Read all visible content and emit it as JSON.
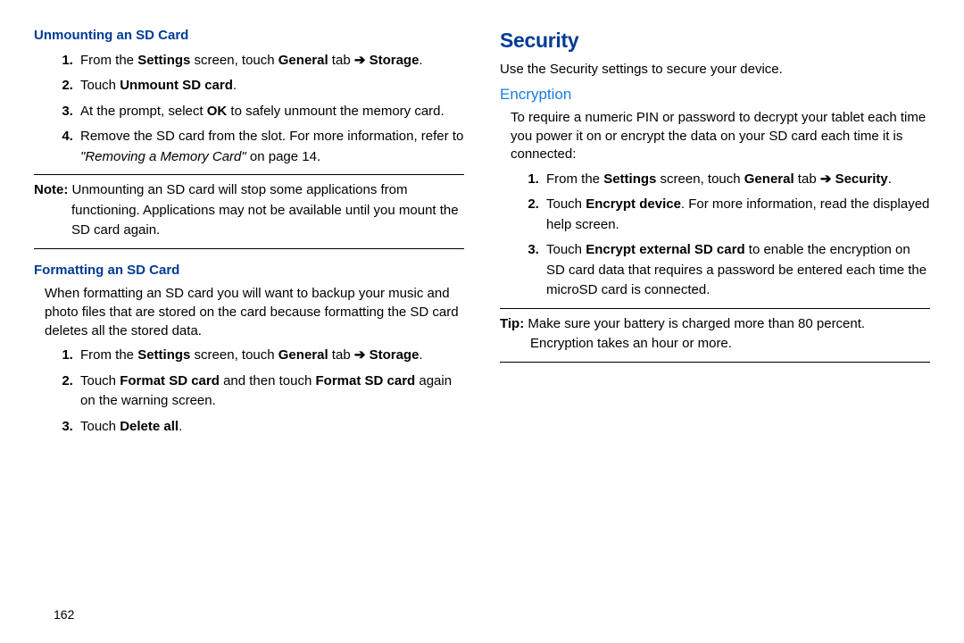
{
  "left": {
    "unmount": {
      "heading": "Unmounting an SD Card",
      "steps": [
        {
          "pre": "From the ",
          "b1": "Settings",
          "mid1": " screen, touch ",
          "b2": "General",
          "mid2": " tab ",
          "arrow": "➔",
          "b3": " Storage",
          "post": "."
        },
        {
          "pre": "Touch ",
          "b1": "Unmount SD card",
          "post": "."
        },
        {
          "pre": "At the prompt, select ",
          "b1": "OK",
          "post": " to safely unmount the memory card."
        },
        {
          "pre": "Remove the SD card from the slot. For more information, refer to ",
          "i1": "\"Removing a Memory Card\"",
          "post": " on page 14."
        }
      ],
      "note_label": "Note:",
      "note_body": " Unmounting an SD card will stop some applications from functioning. Applications may not be available until you mount the SD card again."
    },
    "format": {
      "heading": "Formatting an SD Card",
      "intro": "When formatting an SD card you will want to backup your music and photo files that are stored on the card because formatting the SD card deletes all the stored data.",
      "steps": [
        {
          "pre": "From the ",
          "b1": "Settings",
          "mid1": " screen, touch ",
          "b2": "General",
          "mid2": " tab ",
          "arrow": "➔",
          "b3": " Storage",
          "post": "."
        },
        {
          "pre": "Touch ",
          "b1": "Format SD card",
          "mid1": " and then touch ",
          "b2": "Format SD card",
          "post": " again on the warning screen."
        },
        {
          "pre": "Touch ",
          "b1": "Delete all",
          "post": "."
        }
      ]
    }
  },
  "right": {
    "security": {
      "heading": "Security",
      "intro": "Use the Security settings to secure your device."
    },
    "encryption": {
      "heading": "Encryption",
      "intro": "To require a numeric PIN or password to decrypt your tablet each time you power it on or encrypt the data on your SD card each time it is connected:",
      "steps": [
        {
          "pre": "From the ",
          "b1": "Settings",
          "mid1": " screen, touch ",
          "b2": "General",
          "mid2": " tab ",
          "arrow": "➔",
          "b3": " Security",
          "post": "."
        },
        {
          "pre": "Touch ",
          "b1": "Encrypt device",
          "post": ". For more information, read the displayed help screen."
        },
        {
          "pre": "Touch ",
          "b1": "Encrypt external SD card",
          "post": " to enable the encryption on SD card data that requires a password be entered each time the microSD card is connected."
        }
      ],
      "tip_label": "Tip:",
      "tip_body": " Make sure your battery is charged more than 80 percent. Encryption takes an hour or more."
    }
  },
  "page_number": "162"
}
